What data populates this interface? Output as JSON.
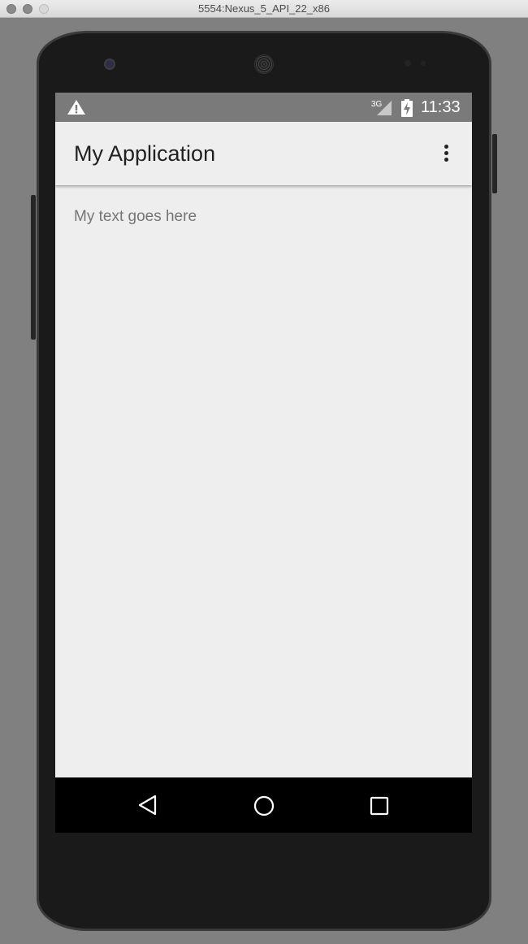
{
  "window": {
    "title": "5554:Nexus_5_API_22_x86"
  },
  "statusbar": {
    "warning_icon": "warning-icon",
    "network_label": "3G",
    "battery_icon": "battery-charging-icon",
    "time": "11:33"
  },
  "appbar": {
    "title": "My Application",
    "overflow_icon": "more-vert-icon"
  },
  "content": {
    "text": "My text goes here"
  },
  "navbar": {
    "back_icon": "back-icon",
    "home_icon": "home-icon",
    "recents_icon": "recents-icon"
  },
  "colors": {
    "statusbar": "#7a7a7a",
    "appbar": "#eeeeee",
    "navbar": "#000000",
    "title_text": "#212121",
    "body_text": "#757575"
  }
}
